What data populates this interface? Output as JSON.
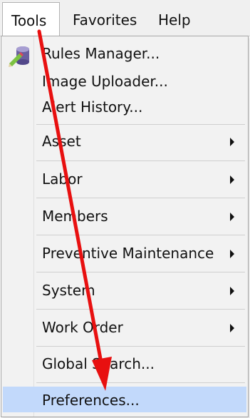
{
  "menubar": {
    "items": [
      {
        "label": "Tools"
      },
      {
        "label": "Favorites"
      },
      {
        "label": "Help"
      }
    ]
  },
  "tools_menu": {
    "items": [
      {
        "label": "Rules Manager...",
        "icon": "rules-manager-icon"
      },
      {
        "label": "Image Uploader..."
      },
      {
        "label": "Alert History..."
      },
      {
        "label": "Asset",
        "submenu": true
      },
      {
        "label": "Labor",
        "submenu": true
      },
      {
        "label": "Members",
        "submenu": true
      },
      {
        "label": "Preventive Maintenance",
        "submenu": true
      },
      {
        "label": "System",
        "submenu": true
      },
      {
        "label": "Work Order",
        "submenu": true
      },
      {
        "label": "Global Search..."
      },
      {
        "label": "Preferences...",
        "highlighted": true
      }
    ]
  },
  "colors": {
    "highlight": "#c2d9fb",
    "annotation_arrow": "#e81010",
    "menu_bg": "#f2f2f2"
  }
}
